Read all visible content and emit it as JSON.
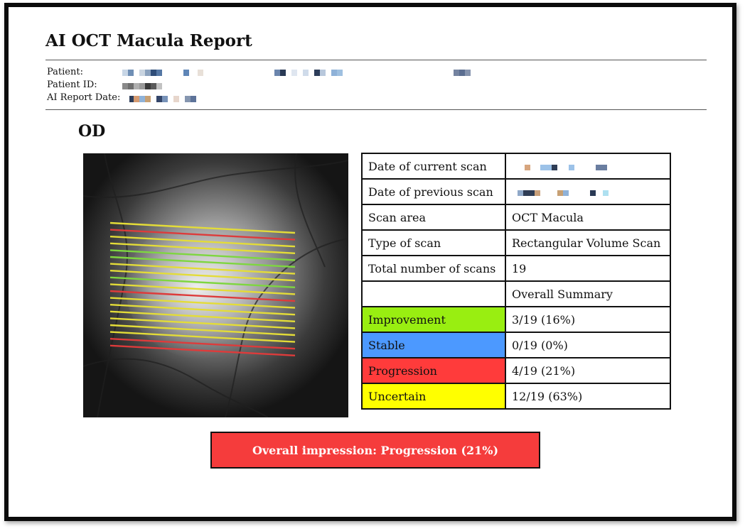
{
  "report": {
    "title": "AI OCT Macula Report",
    "patient_label": "Patient:",
    "patient_id_label": "Patient ID:",
    "report_date_label": "AI Report Date:",
    "eye": "OD"
  },
  "summary_table": {
    "rows": [
      {
        "label": "Date of current scan",
        "value": ""
      },
      {
        "label": "Date of previous scan",
        "value": ""
      },
      {
        "label": "Scan area",
        "value": "OCT Macula"
      },
      {
        "label": "Type of scan",
        "value": "Rectangular Volume Scan"
      },
      {
        "label": "Total number of scans",
        "value": "19"
      },
      {
        "label": "",
        "value": "Overall Summary"
      },
      {
        "label": "Improvement",
        "value": "3/19 (16%)",
        "color": "#99ee11"
      },
      {
        "label": "Stable",
        "value": "0/19 (0%)",
        "color": "#4c99ff"
      },
      {
        "label": "Progression",
        "value": "4/19 (21%)",
        "color": "#ff3b3b"
      },
      {
        "label": "Uncertain",
        "value": "12/19 (63%)",
        "color": "#ffff00"
      }
    ]
  },
  "scan_lines": {
    "statuses": [
      "uncertain",
      "progression",
      "uncertain",
      "uncertain",
      "improvement",
      "improvement",
      "uncertain",
      "uncertain",
      "improvement",
      "uncertain",
      "progression",
      "uncertain",
      "uncertain",
      "uncertain",
      "uncertain",
      "uncertain",
      "uncertain",
      "progression",
      "progression"
    ],
    "colors": {
      "uncertain": "#e3dc38",
      "progression": "#dd3b3b",
      "improvement": "#7ed640"
    }
  },
  "impression": {
    "text": "Overall impression: Progression (21%)",
    "color": "#f53c3c"
  }
}
